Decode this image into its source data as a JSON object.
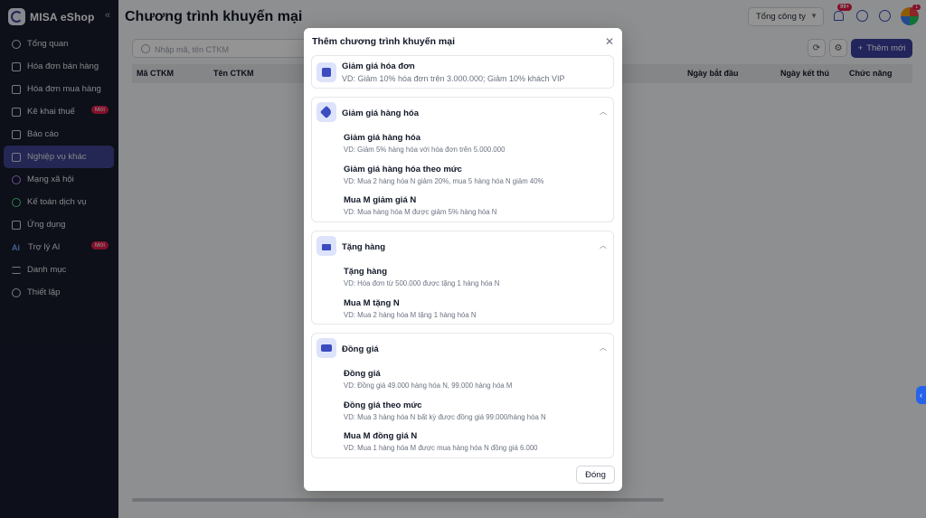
{
  "brand": {
    "name": "MISA eShop"
  },
  "sidebar": {
    "collapse_icon": "«",
    "items": [
      {
        "label": "Tổng quan"
      },
      {
        "label": "Hóa đơn bán hàng"
      },
      {
        "label": "Hóa đơn mua hàng"
      },
      {
        "label": "Kê khai thuế",
        "badge": "Mới"
      },
      {
        "label": "Báo cáo"
      },
      {
        "label": "Nghiệp vụ khác",
        "active": true
      },
      {
        "label": "Mạng xã hội"
      },
      {
        "label": "Kế toán dịch vụ"
      },
      {
        "label": "Ứng dụng"
      },
      {
        "label": "Trợ lý AI",
        "badge": "Mới"
      },
      {
        "label": "Danh mục"
      },
      {
        "label": "Thiết lập"
      }
    ]
  },
  "header": {
    "title": "Chương trình khuyến mại",
    "company_select": "Tổng công ty",
    "notification_count": "99+",
    "avatar_badge": "1"
  },
  "toolbar": {
    "search_placeholder": "Nhập mã, tên CTKM",
    "add_label": "Thêm mới"
  },
  "grid": {
    "columns": [
      "Mã CTKM",
      "Tên CTKM",
      "Ngày bắt đầu",
      "Ngày kết thú",
      "Chức năng"
    ]
  },
  "modal": {
    "title": "Thêm chương trình khuyến mại",
    "close_label": "Đóng",
    "invoice_discount": {
      "title": "Giảm giá hóa đơn",
      "desc": "VD: Giảm 10% hóa đơn trên 3.000.000; Giảm 10% khách VIP"
    },
    "groups": [
      {
        "title": "Giảm giá hàng hóa",
        "icon": "tag-icon",
        "items": [
          {
            "title": "Giảm giá hàng hóa",
            "desc": "VD: Giảm 5% hàng hóa với hóa đơn trên 5.000.000"
          },
          {
            "title": "Giảm giá hàng hóa theo mức",
            "desc": "VD: Mua 2 hàng hóa N giảm 20%, mua 5 hàng hóa N giảm 40%"
          },
          {
            "title": "Mua M giảm giá N",
            "desc": "VD: Mua hàng hóa M được giảm 5% hàng hóa N"
          }
        ]
      },
      {
        "title": "Tặng hàng",
        "icon": "gift-icon",
        "items": [
          {
            "title": "Tặng hàng",
            "desc": "VD: Hóa đơn từ 500.000 được tặng 1 hàng hóa N"
          },
          {
            "title": "Mua M tặng N",
            "desc": "VD: Mua 2 hàng hóa M tặng 1 hàng hóa N"
          }
        ]
      },
      {
        "title": "Đồng giá",
        "icon": "money-icon",
        "items": [
          {
            "title": "Đồng giá",
            "desc": "VD: Đồng giá 49.000 hàng hóa N, 99.000 hàng hóa M"
          },
          {
            "title": "Đồng giá theo mức",
            "desc": "VD: Mua 3 hàng hóa N bất kỳ được đồng giá 99.000/hàng hóa N"
          },
          {
            "title": "Mua M đồng giá N",
            "desc": "VD: Mua 1 hàng hóa M được mua hàng hóa N đồng giá 6.000"
          }
        ]
      }
    ]
  },
  "colors": {
    "primary": "#3b3f9f",
    "sidebar_bg": "#171a2c",
    "badge": "#e11d48"
  }
}
